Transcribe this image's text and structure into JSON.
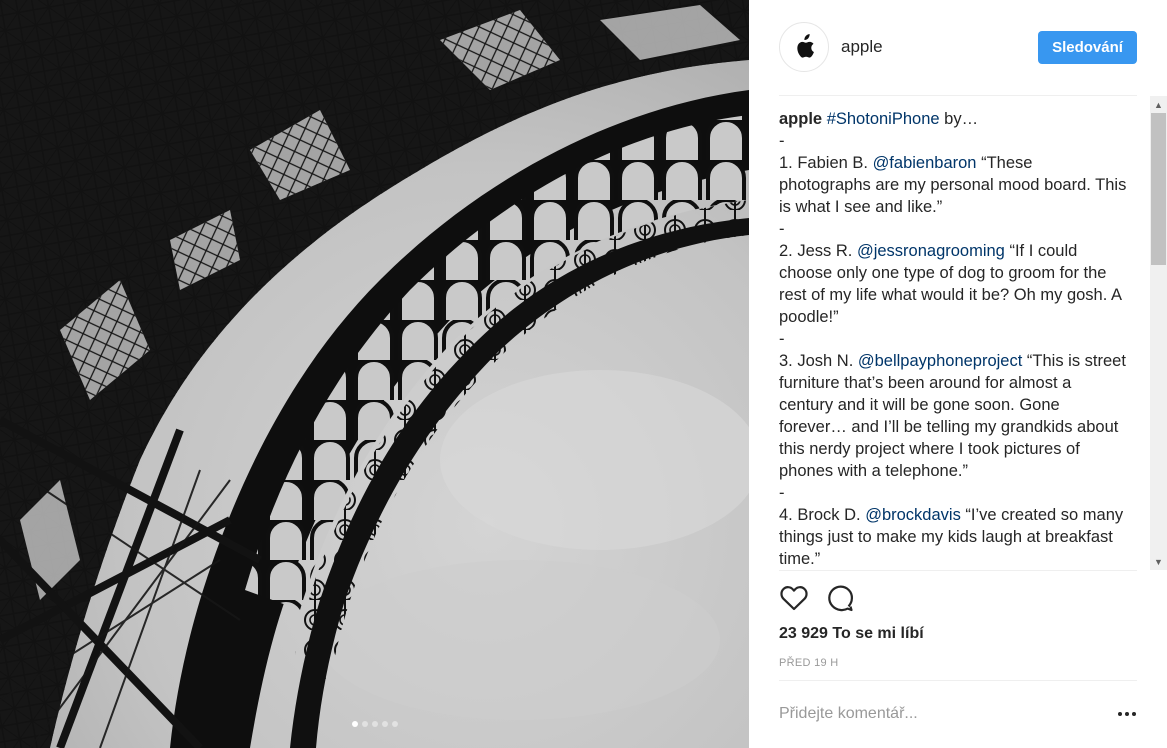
{
  "post": {
    "username": "apple",
    "follow_label": "Sledování",
    "caption": {
      "username": "apple",
      "intro_tag": "#ShotoniPhone",
      "intro_rest": " by…",
      "separator": "-",
      "entries": [
        {
          "prefix": "1. Fabien B. ",
          "handle": "@fabienbaron",
          "quote": " “These photographs are my personal mood board. This is what I see and like.”"
        },
        {
          "prefix": "2. Jess R. ",
          "handle": "@jessronagrooming",
          "quote": " “If I could choose only one type of dog to groom for the rest of my life what would it be? Oh my gosh. A poodle!”"
        },
        {
          "prefix": "3. Josh N. ",
          "handle": "@bellpayphoneproject",
          "quote": " “This is street furniture that’s been around for almost a century and it will be gone soon. Gone forever… and I’ll be telling my grandkids about this nerdy project where I took pictures of phones with a telephone.”"
        },
        {
          "prefix": "4. Brock D. ",
          "handle": "@brockdavis",
          "quote": " “I’ve created so many things just to make my kids laugh at breakfast time.”"
        }
      ]
    },
    "likes_text": "23 929 To se mi líbí",
    "timestamp": "PŘED 19 H",
    "comment_placeholder": "Přidejte komentář...",
    "carousel": {
      "total": 5,
      "active_index": 0
    }
  },
  "icons": {
    "avatar": "apple-logo-icon",
    "like": "heart-icon",
    "comment": "comment-bubble-icon",
    "more": "more-options-icon"
  },
  "colors": {
    "follow_button": "#3897f0",
    "link": "#003569",
    "text": "#262626",
    "muted": "#999999"
  }
}
